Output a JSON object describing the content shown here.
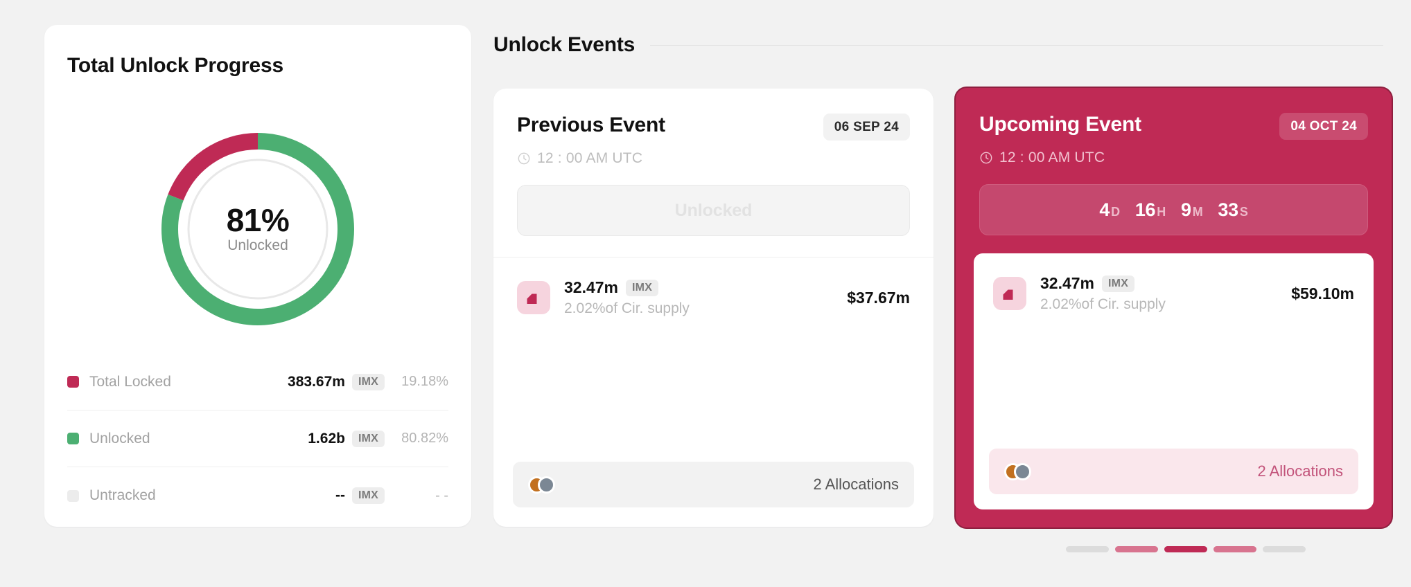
{
  "progress_card": {
    "title": "Total Unlock Progress",
    "donut": {
      "percent_label": "81%",
      "sub_label": "Unlocked"
    },
    "legend": [
      {
        "label": "Total Locked",
        "value": "383.67m",
        "chip": "IMX",
        "percent": "19.18%",
        "color": "#bf2a55"
      },
      {
        "label": "Unlocked",
        "value": "1.62b",
        "chip": "IMX",
        "percent": "80.82%",
        "color": "#4caf72"
      },
      {
        "label": "Untracked",
        "value": "--",
        "chip": "IMX",
        "percent": "- -",
        "color": "#ececec"
      }
    ]
  },
  "section": {
    "title": "Unlock Events"
  },
  "previous_event": {
    "title": "Previous Event",
    "date_badge": "06 SEP 24",
    "time": "12 : 00 AM UTC",
    "status_label": "Unlocked",
    "token": {
      "amount": "32.47m",
      "chip": "IMX",
      "sub": "2.02%of Cir. supply",
      "usd": "$37.67m"
    },
    "allocations": {
      "text": "2  Allocations",
      "avatar_colors": [
        "#c2701f",
        "#7b8794"
      ]
    }
  },
  "upcoming_event": {
    "title": "Upcoming Event",
    "date_badge": "04 OCT 24",
    "time": "12 : 00 AM UTC",
    "countdown": {
      "days": "4",
      "days_unit": "D",
      "hours": "16",
      "hours_unit": "H",
      "minutes": "9",
      "minutes_unit": "M",
      "seconds": "33",
      "seconds_unit": "S"
    },
    "token": {
      "amount": "32.47m",
      "chip": "IMX",
      "sub": "2.02%of Cir. supply",
      "usd": "$59.10m"
    },
    "allocations": {
      "text": "2  Allocations",
      "avatar_colors": [
        "#c2701f",
        "#7b8794"
      ]
    }
  },
  "pagination": {
    "bars": [
      "#dcdcdc",
      "#d8748f",
      "#bf2a55",
      "#d8748f",
      "#dcdcdc"
    ],
    "active_index": 2
  },
  "chart_data": {
    "type": "pie",
    "title": "Total Unlock Progress",
    "categories": [
      "Total Locked",
      "Unlocked",
      "Untracked"
    ],
    "values": [
      19.18,
      80.82,
      0
    ],
    "value_labels": [
      "383.67m IMX",
      "1.62b IMX",
      "-- IMX"
    ],
    "colors": [
      "#bf2a55",
      "#4caf72",
      "#ececec"
    ],
    "center_label": "81%",
    "center_sublabel": "Unlocked",
    "unit": "%",
    "legend_position": "bottom"
  }
}
